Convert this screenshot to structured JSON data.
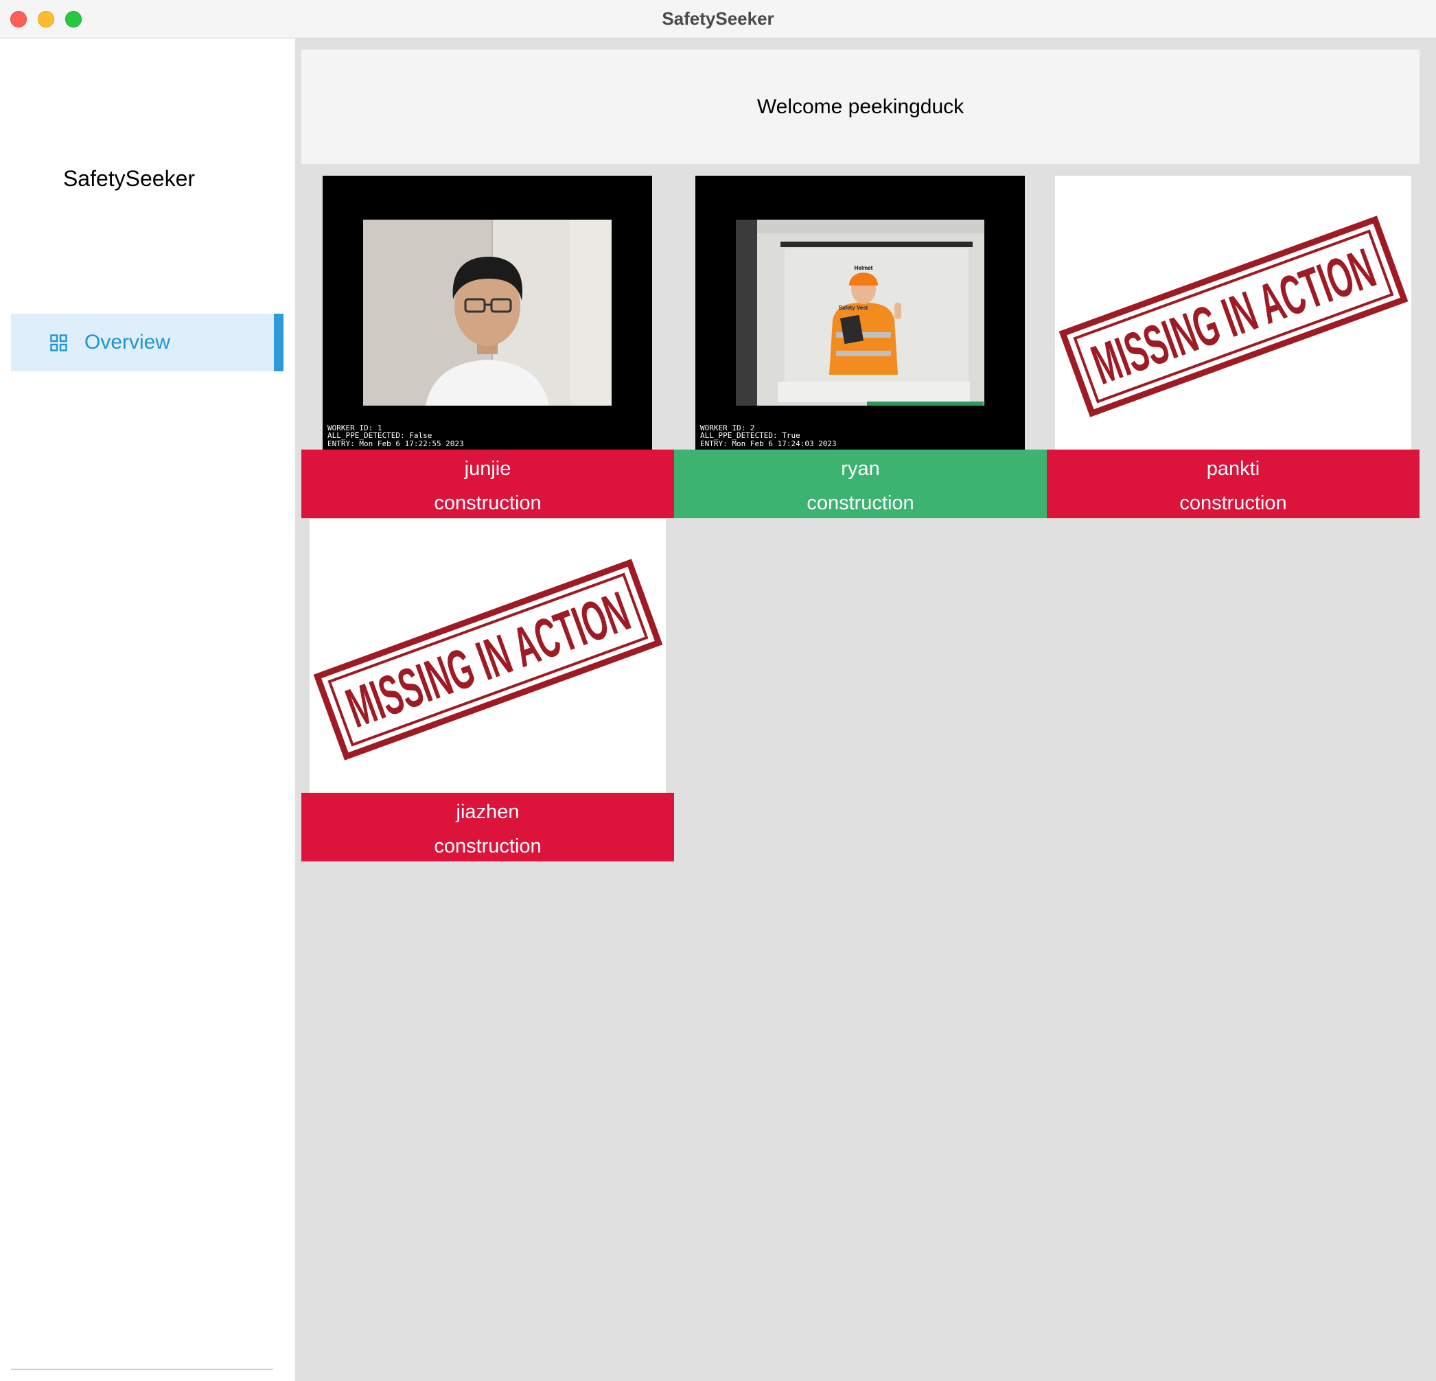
{
  "window": {
    "title": "SafetySeeker"
  },
  "sidebar": {
    "brand": "SafetySeeker",
    "nav": [
      {
        "label": "Overview",
        "icon": "grid-icon",
        "active": true
      }
    ]
  },
  "main": {
    "welcome": "Welcome peekingduck",
    "workers": [
      {
        "name": "junjie",
        "department": "construction",
        "status_color": "#dc143c",
        "feed": {
          "worker_id": "WORKER_ID: 1",
          "ppe": "ALL_PPE_DETECTED: False",
          "entry": "ENTRY: Mon Feb 6 17:22:55 2023"
        }
      },
      {
        "name": "ryan",
        "department": "construction",
        "status_color": "#3cb371",
        "feed": {
          "worker_id": "WORKER_ID: 2",
          "ppe": "ALL_PPE_DETECTED: True",
          "entry": "ENTRY: Mon Feb 6 17:24:03 2023",
          "labels": [
            "Helmet",
            "Safety Vest"
          ]
        }
      },
      {
        "name": "pankti",
        "department": "construction",
        "status_color": "#dc143c",
        "stamp": "MISSING IN ACTION"
      },
      {
        "name": "jiazhen",
        "department": "construction",
        "status_color": "#dc143c",
        "stamp": "MISSING IN ACTION"
      }
    ]
  },
  "colors": {
    "accent": "#2f9ad8",
    "alert": "#dc143c",
    "ok": "#3cb371"
  }
}
